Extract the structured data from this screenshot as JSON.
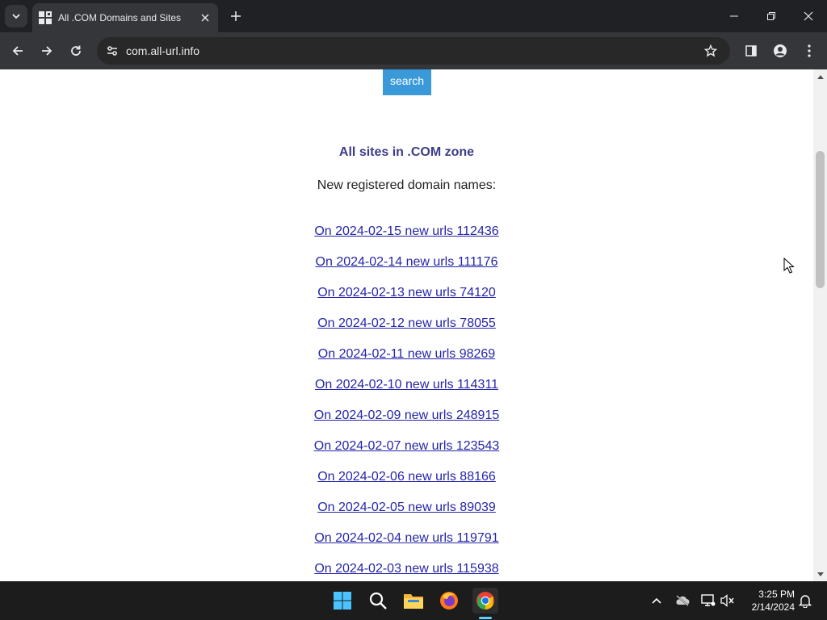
{
  "browser": {
    "tab_title": "All .COM Domains and Sites",
    "url": "com.all-url.info"
  },
  "page": {
    "search_label": "search",
    "zone_title": "All sites in .COM zone",
    "subtitle": "New registered domain names:",
    "links": [
      "On 2024-02-15 new urls 112436",
      "On 2024-02-14 new urls 111176",
      "On 2024-02-13 new urls 74120",
      "On 2024-02-12 new urls 78055",
      "On 2024-02-11 new urls 98269",
      "On 2024-02-10 new urls 114311",
      "On 2024-02-09 new urls 248915",
      "On 2024-02-07 new urls 123543",
      "On 2024-02-06 new urls 88166",
      "On 2024-02-05 new urls 89039",
      "On 2024-02-04 new urls 119791",
      "On 2024-02-03 new urls 115938"
    ]
  },
  "taskbar": {
    "apps": [
      "windows-start-icon",
      "search-icon",
      "file-explorer-icon",
      "firefox-icon",
      "chrome-icon"
    ],
    "time": "3:25 PM",
    "date": "2/14/2024"
  },
  "colors": {
    "accent_blue": "#3a9ad9",
    "title_purple": "#3c3d8a",
    "link": "#2525a8"
  }
}
